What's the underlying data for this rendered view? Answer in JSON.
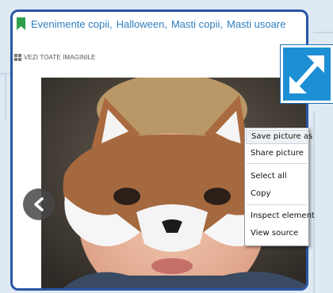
{
  "tags": {
    "items": [
      "Evenimente copii",
      "Halloween",
      "Masti copii",
      "Masti usoare"
    ],
    "separator": ","
  },
  "gallery": {
    "view_all_label": "VEZI TOATE IMAGINILE",
    "prev_icon": "chevron-left-icon",
    "expand_icon": "expand-arrows-icon"
  },
  "context_menu": {
    "items": [
      "Save picture as",
      "Share picture",
      "Select all",
      "Copy",
      "Inspect element",
      "View source"
    ]
  },
  "colors": {
    "frame_border": "#2a56a6",
    "tag_text": "#2f7fbf",
    "tag_icon": "#2e9e4a",
    "expand_button": "#1d8fd4"
  }
}
